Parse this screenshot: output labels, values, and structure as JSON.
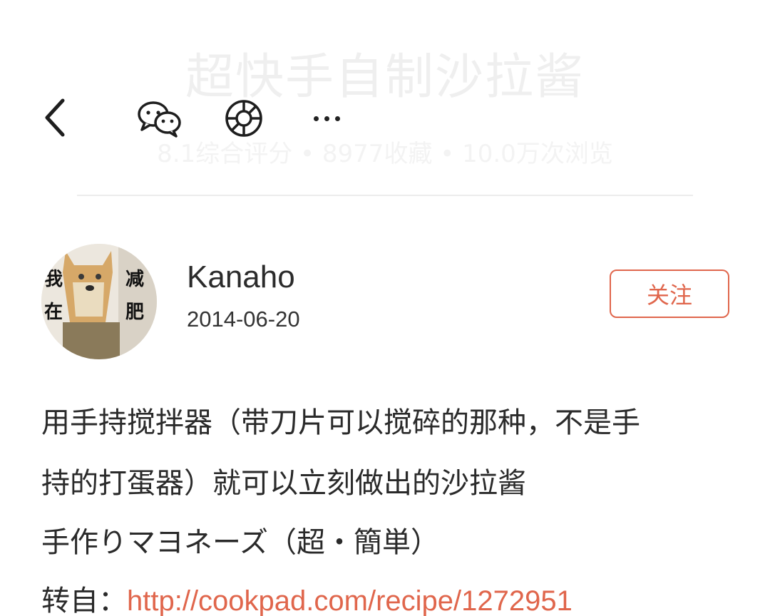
{
  "header": {
    "title": "超快手自制沙拉酱",
    "stats": "8.1综合评分 • 8977收藏 • 10.0万次浏览"
  },
  "toolbar": {
    "back_icon": "chevron-left-icon",
    "wechat_icon": "wechat-icon",
    "moments_icon": "moments-icon",
    "more_icon": "more-icon"
  },
  "author": {
    "name": "Kanaho",
    "date": "2014-06-20",
    "avatar_text": [
      "我",
      "在",
      "减",
      "肥"
    ],
    "follow_label": "关注"
  },
  "description": {
    "line1": "用手持搅拌器（带刀片可以搅碎的那种，不是手",
    "line2": "持的打蛋器）就可以立刻做出的沙拉酱",
    "line3": "手作りマヨネーズ（超・簡単）",
    "source_prefix": "转自：",
    "source_link": "http://cookpad.com/recipe/1272951"
  },
  "colors": {
    "accent": "#e0664c"
  }
}
